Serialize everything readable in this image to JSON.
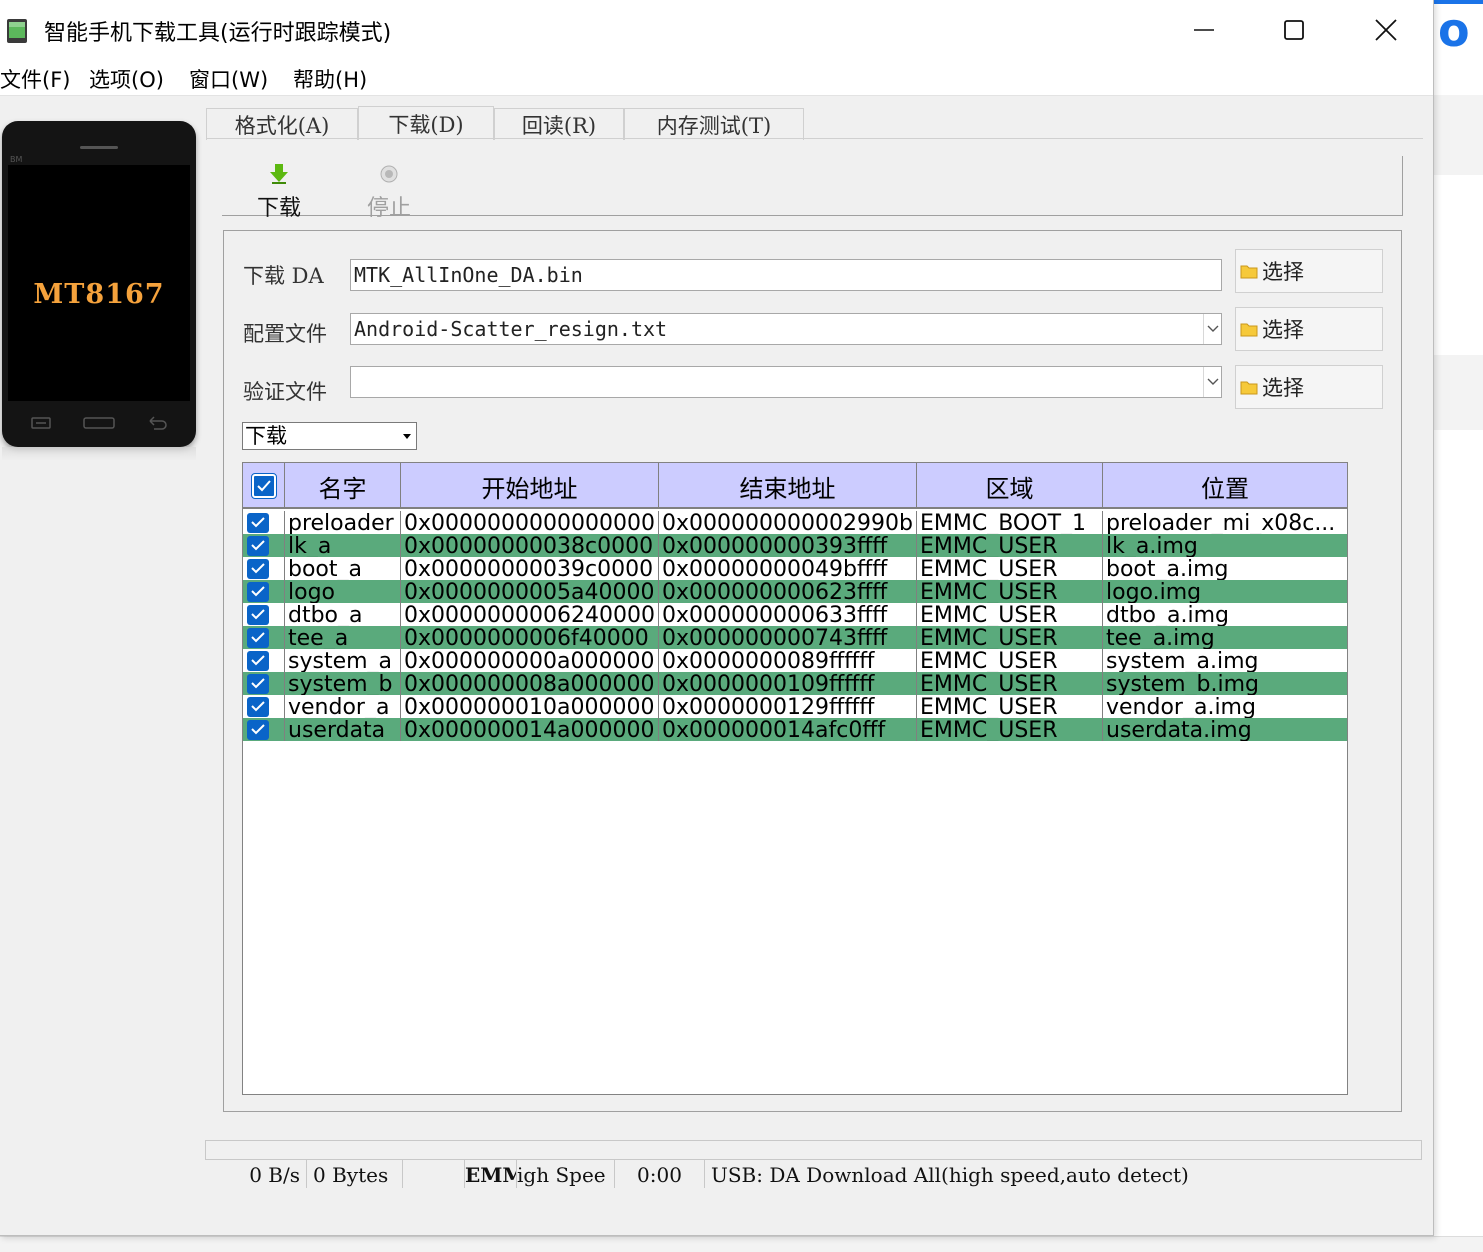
{
  "window": {
    "title": "智能手机下载工具(运行时跟踪模式)"
  },
  "menu": [
    "文件(F)",
    "选项(O)",
    "窗口(W)",
    "帮助(H)"
  ],
  "phone": {
    "brand": "BM",
    "model": "MT8167"
  },
  "tabs": [
    "格式化(A)",
    "下载(D)",
    "回读(R)",
    "内存测试(T)"
  ],
  "active_tab": 1,
  "toolbar": {
    "download_label": "下载",
    "stop_label": "停止"
  },
  "form": {
    "da_label": "下载 DA",
    "da_value": "MTK_AllInOne_DA.bin",
    "config_label": "配置文件",
    "config_value": "Android-Scatter_resign.txt",
    "auth_label": "验证文件",
    "auth_value": "",
    "select_label": "选择",
    "mode_value": "下载"
  },
  "table": {
    "headers": [
      "名字",
      "开始地址",
      "结束地址",
      "区域",
      "位置"
    ],
    "rows": [
      [
        "preloader",
        "0x0000000000000000",
        "0x000000000002990b",
        "EMMC_BOOT_1",
        "preloader_mi_x08c..."
      ],
      [
        "lk_a",
        "0x00000000038c0000",
        "0x000000000393ffff",
        "EMMC_USER",
        "lk_a.img"
      ],
      [
        "boot_a",
        "0x00000000039c0000",
        "0x00000000049bffff",
        "EMMC_USER",
        "boot_a.img"
      ],
      [
        "logo",
        "0x0000000005a40000",
        "0x000000000623ffff",
        "EMMC_USER",
        "logo.img"
      ],
      [
        "dtbo_a",
        "0x0000000006240000",
        "0x000000000633ffff",
        "EMMC_USER",
        "dtbo_a.img"
      ],
      [
        "tee_a",
        "0x0000000006f40000",
        "0x000000000743ffff",
        "EMMC_USER",
        "tee_a.img"
      ],
      [
        "system_a",
        "0x000000000a000000",
        "0x0000000089ffffff",
        "EMMC_USER",
        "system_a.img"
      ],
      [
        "system_b",
        "0x000000008a000000",
        "0x0000000109ffffff",
        "EMMC_USER",
        "system_b.img"
      ],
      [
        "vendor_a",
        "0x000000010a000000",
        "0x0000000129ffffff",
        "EMMC_USER",
        "vendor_a.img"
      ],
      [
        "userdata",
        "0x000000014a000000",
        "0x000000014afc0fff",
        "EMMC_USER",
        "userdata.img"
      ]
    ]
  },
  "status": {
    "speed": "0 B/s",
    "bytes": "0 Bytes",
    "storage": "EMMC",
    "mode_short": "igh Spee",
    "time": "0:00",
    "usb": "USB: DA Download All(high speed,auto detect)"
  },
  "colors": {
    "header_bg": "#ccccff",
    "row_alt": "#5aaa7c",
    "checkbox": "#0a64c8",
    "phone_model": "#f5a23c"
  }
}
